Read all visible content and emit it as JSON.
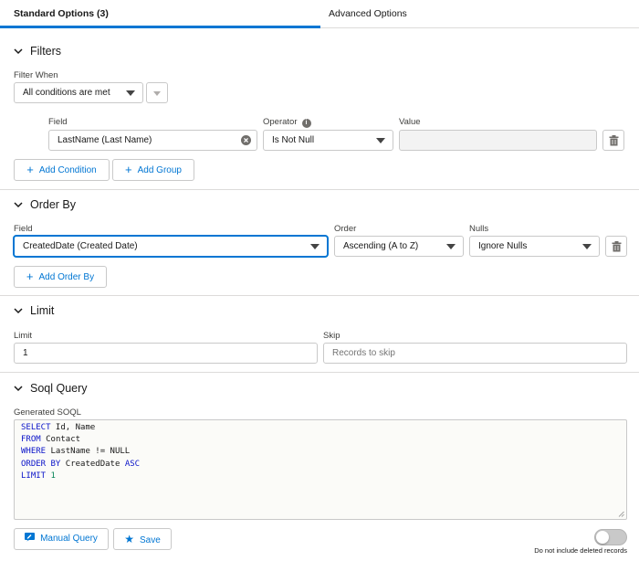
{
  "tabs": [
    {
      "label": "Standard Options (3)",
      "active": true
    },
    {
      "label": "Advanced Options",
      "active": false
    }
  ],
  "filters": {
    "title": "Filters",
    "filter_when_label": "Filter When",
    "filter_when_value": "All conditions are met",
    "columns": {
      "field": "Field",
      "operator": "Operator",
      "value": "Value"
    },
    "row": {
      "field": "LastName (Last Name)",
      "operator": "Is Not Null",
      "value": ""
    },
    "add_condition": "Add Condition",
    "add_group": "Add Group"
  },
  "order_by": {
    "title": "Order By",
    "field_label": "Field",
    "order_label": "Order",
    "nulls_label": "Nulls",
    "field_value": "CreatedDate (Created Date)",
    "order_value": "Ascending (A to Z)",
    "nulls_value": "Ignore Nulls",
    "add_order_by": "Add Order By"
  },
  "limit": {
    "title": "Limit",
    "limit_label": "Limit",
    "limit_value": "1",
    "skip_label": "Skip",
    "skip_placeholder": "Records to skip"
  },
  "soql": {
    "title": "Soql Query",
    "generated_label": "Generated SOQL",
    "lines": [
      {
        "kw": "SELECT",
        "rest": " Id, Name"
      },
      {
        "kw": "FROM",
        "rest": " Contact"
      },
      {
        "kw": "WHERE",
        "rest": " LastName != NULL"
      },
      {
        "kw": "ORDER BY",
        "rest": " CreatedDate ",
        "kw2": "ASC"
      },
      {
        "kw": "LIMIT",
        "rest": " ",
        "num": "1"
      }
    ],
    "manual_query": "Manual Query",
    "save": "Save",
    "deleted_toggle_label": "Do not include deleted records"
  },
  "colors": {
    "accent": "#0176d3",
    "border": "#c9c9c9",
    "keyword": "#0b14c9",
    "number": "#098658"
  }
}
